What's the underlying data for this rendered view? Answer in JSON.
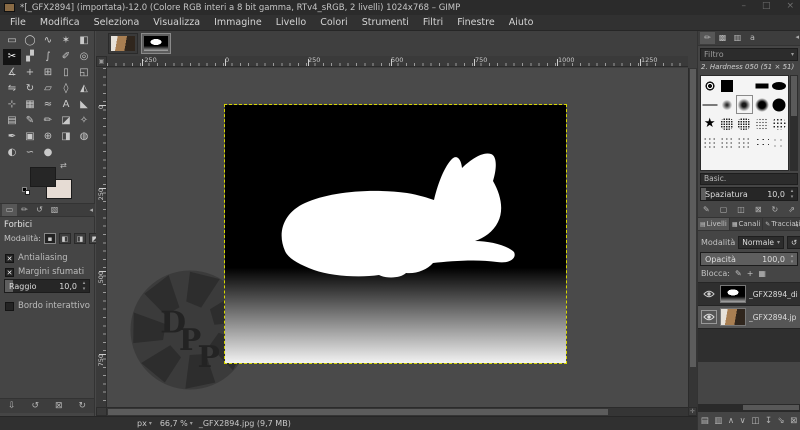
{
  "window": {
    "title": "*[_GFX2894] (importata)-12.0 (Colore RGB interi a 8 bit gamma, RTv4_sRGB, 2 livelli) 1024x768 – GIMP",
    "controls": [
      "–",
      "□",
      "×"
    ]
  },
  "menu": {
    "items": [
      "File",
      "Modifica",
      "Seleziona",
      "Visualizza",
      "Immagine",
      "Livello",
      "Colori",
      "Strumenti",
      "Filtri",
      "Finestre",
      "Aiuto"
    ]
  },
  "toolbox": {
    "fg_color": "#262626",
    "bg_color": "#e6dcd4",
    "tools": [
      {
        "n": "rectangle-select",
        "g": "▭"
      },
      {
        "n": "ellipse-select",
        "g": "◯"
      },
      {
        "n": "free-select",
        "g": "∿"
      },
      {
        "n": "fuzzy-select",
        "g": "✶"
      },
      {
        "n": "select-by-color",
        "g": "◧"
      },
      {
        "n": "scissors-select",
        "g": "✂",
        "active": true
      },
      {
        "n": "foreground-select",
        "g": "▞"
      },
      {
        "n": "paths",
        "g": "∫"
      },
      {
        "n": "color-picker",
        "g": "✐"
      },
      {
        "n": "zoom",
        "g": "◎"
      },
      {
        "n": "measure",
        "g": "∡"
      },
      {
        "n": "move",
        "g": "+"
      },
      {
        "n": "align",
        "g": "⊞"
      },
      {
        "n": "crop",
        "g": "▯"
      },
      {
        "n": "unified-transform",
        "g": "◱"
      },
      {
        "n": "flip",
        "g": "⇋"
      },
      {
        "n": "rotate",
        "g": "↻"
      },
      {
        "n": "shear",
        "g": "▱"
      },
      {
        "n": "perspective",
        "g": "◊"
      },
      {
        "n": "transform-3d",
        "g": "◭"
      },
      {
        "n": "n-point-deformation",
        "g": "⊹"
      },
      {
        "n": "cage-transform",
        "g": "▦"
      },
      {
        "n": "warp-transform",
        "g": "≈"
      },
      {
        "n": "text",
        "g": "A"
      },
      {
        "n": "bucket-fill",
        "g": "◣"
      },
      {
        "n": "gradient",
        "g": "▤"
      },
      {
        "n": "pencil",
        "g": "✎"
      },
      {
        "n": "paintbrush",
        "g": "✏"
      },
      {
        "n": "eraser",
        "g": "◪"
      },
      {
        "n": "airbrush",
        "g": "✧"
      },
      {
        "n": "ink",
        "g": "✒"
      },
      {
        "n": "clone",
        "g": "▣"
      },
      {
        "n": "heal",
        "g": "⊕"
      },
      {
        "n": "perspective-clone",
        "g": "◨"
      },
      {
        "n": "convolve-blur",
        "g": "◍"
      },
      {
        "n": "dodge-burn",
        "g": "◐"
      },
      {
        "n": "smudge",
        "g": "∽"
      },
      {
        "n": "paint-blob",
        "g": "●"
      }
    ]
  },
  "tool_options": {
    "tabs": [
      {
        "n": "tab-tool-options",
        "g": "▭",
        "active": true
      },
      {
        "n": "tab-device-status",
        "g": "✏"
      },
      {
        "n": "tab-undo-history",
        "g": "↺"
      },
      {
        "n": "tab-images",
        "g": "▧"
      }
    ],
    "title": "Forbici",
    "mode_label": "Modalità:",
    "mode_buttons": [
      {
        "n": "mode-replace",
        "g": "▪",
        "sel": true
      },
      {
        "n": "mode-add",
        "g": "◧"
      },
      {
        "n": "mode-subtract",
        "g": "◨"
      },
      {
        "n": "mode-intersect",
        "g": "◩"
      }
    ],
    "checkboxes": [
      {
        "label": "Antialiasing",
        "checked": true
      },
      {
        "label": "Margini sfumati",
        "checked": true
      }
    ],
    "radius_label": "Raggio",
    "radius_value": "10,0",
    "interactive_label": "Bordo interattivo",
    "interactive_checked": false,
    "footer_buttons": [
      {
        "n": "save-tool-preset",
        "g": "⇩"
      },
      {
        "n": "restore-tool-preset",
        "g": "↺"
      },
      {
        "n": "delete-tool-preset",
        "g": "⊠"
      },
      {
        "n": "reset-tool-options",
        "g": "↻"
      }
    ]
  },
  "canvas": {
    "hruler": [
      "-250",
      "0",
      "250",
      "500",
      "750",
      "1000",
      "1250"
    ],
    "vruler": [
      "0",
      "250",
      "500",
      "750"
    ],
    "watermark_letters": [
      "D",
      "P",
      "P"
    ]
  },
  "statusbar": {
    "unit": "px",
    "zoom": "66,7 %",
    "file_info": "_GFX2894.jpg (9,7 MB)"
  },
  "brushes_dock": {
    "tabs": [
      {
        "n": "tab-brushes",
        "g": "✏",
        "active": true
      },
      {
        "n": "tab-patterns",
        "g": "▩"
      },
      {
        "n": "tab-gradients",
        "g": "▥"
      },
      {
        "n": "tab-fonts",
        "g": "a"
      }
    ],
    "filter_label": "Filtro",
    "selected_brush": "2. Hardness 050 (51 × 51)",
    "tag_value": "Basic.",
    "spacing_label": "Spaziatura",
    "spacing_value": "10,0",
    "items": [
      {
        "t": "wilber"
      },
      {
        "t": "square"
      },
      {
        "t": "blank"
      },
      {
        "t": "bar"
      },
      {
        "t": "ellipse"
      },
      {
        "t": "line"
      },
      {
        "t": "soft1"
      },
      {
        "t": "soft2",
        "selected": true
      },
      {
        "t": "soft3"
      },
      {
        "t": "circle"
      },
      {
        "t": "star"
      },
      {
        "t": "tex1"
      },
      {
        "t": "tex2"
      },
      {
        "t": "tex3"
      },
      {
        "t": "tex4"
      },
      {
        "t": "dots1"
      },
      {
        "t": "dots2"
      },
      {
        "t": "dots3"
      },
      {
        "t": "dots4"
      },
      {
        "t": "dots5"
      }
    ],
    "buttons": [
      {
        "n": "edit-brush",
        "g": "✎"
      },
      {
        "n": "new-brush",
        "g": "▢"
      },
      {
        "n": "duplicate-brush",
        "g": "◫"
      },
      {
        "n": "delete-brush",
        "g": "⊠"
      },
      {
        "n": "refresh-brushes",
        "g": "↻"
      },
      {
        "n": "open-brush-as-image",
        "g": "⇗"
      }
    ]
  },
  "layers_dock": {
    "pages": [
      {
        "label": "Livelli",
        "g": "▤",
        "active": true
      },
      {
        "label": "Canali",
        "g": "▦"
      },
      {
        "label": "Tracciati",
        "g": "✎"
      }
    ],
    "mode_label": "Modalità",
    "mode_value": "Normale",
    "mode_switch_glyph": "↺",
    "opacity_label": "Opacità",
    "opacity_value": "100,0",
    "lock_label": "Blocca:",
    "lock_buttons": [
      {
        "n": "lock-pixels",
        "g": "✎"
      },
      {
        "n": "lock-position",
        "g": "+"
      },
      {
        "n": "lock-alpha",
        "g": "▦"
      }
    ],
    "layers": [
      {
        "name": "_GFX2894_di",
        "selected": false
      },
      {
        "name": "_GFX2894.jp",
        "selected": true
      }
    ],
    "buttons": [
      {
        "n": "new-layer",
        "g": "▤"
      },
      {
        "n": "new-layer-group",
        "g": "▥"
      },
      {
        "n": "raise-layer",
        "g": "∧"
      },
      {
        "n": "lower-layer",
        "g": "∨"
      },
      {
        "n": "duplicate-layer",
        "g": "◫"
      },
      {
        "n": "anchor-layer",
        "g": "↧"
      },
      {
        "n": "merge-layer",
        "g": "⇘"
      },
      {
        "n": "delete-layer",
        "g": "⊠"
      }
    ]
  }
}
